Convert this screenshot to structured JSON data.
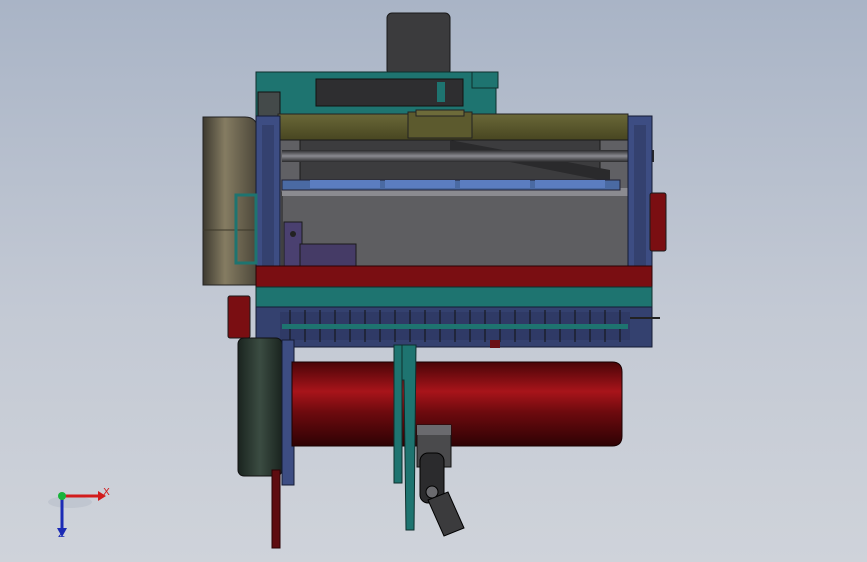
{
  "viewport": {
    "background_top": "#a9b4c6",
    "background_bottom": "#cfd3da"
  },
  "triad": {
    "x_label": "X",
    "z_label": "Z",
    "x_color": "#d21c1c",
    "y_color": "#19b33a",
    "z_color": "#1b2bb5"
  },
  "colors": {
    "teal": "#1e7470",
    "navy": "#3d4d83",
    "olive": "#59572e",
    "dark_red": "#7a0e12",
    "grey": "#5b5b5e",
    "dark_grey": "#3a3a3c",
    "bronze": "#6e6650",
    "dark_green": "#2d3b33"
  }
}
